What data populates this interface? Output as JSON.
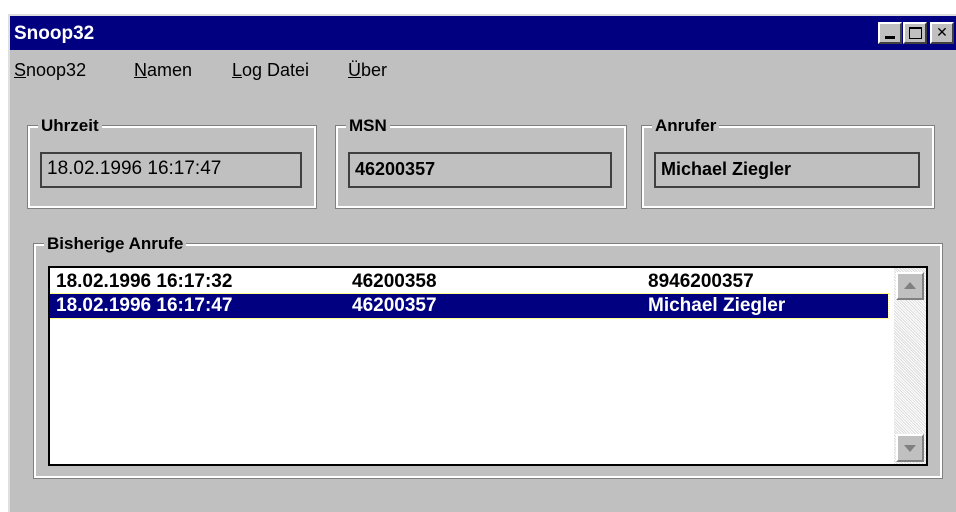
{
  "window": {
    "title": "Snoop32",
    "minimize_glyph": "",
    "maximize_glyph": "",
    "close_glyph": "✕"
  },
  "menu": [
    {
      "first": "S",
      "rest": "noop32"
    },
    {
      "first": "N",
      "rest": "amen"
    },
    {
      "first": "L",
      "rest": "og Datei"
    },
    {
      "first": "Ü",
      "rest": "ber"
    }
  ],
  "uhrzeit": {
    "label": "Uhrzeit",
    "value": "18.02.1996  16:17:47"
  },
  "msn": {
    "label": "MSN",
    "value": "46200357"
  },
  "anrufer": {
    "label": "Anrufer",
    "value": "Michael Ziegler"
  },
  "calls": {
    "label": "Bisherige Anrufe",
    "rows": [
      {
        "time": "18.02.1996  16:17:32",
        "msn": "46200358",
        "caller": "8946200357"
      },
      {
        "time": "18.02.1996  16:17:47",
        "msn": "46200357",
        "caller": "Michael Ziegler"
      }
    ],
    "selected_index": 1
  },
  "colors": {
    "titlebar": "#000080",
    "face": "#c0c0c0",
    "selection": "#000080"
  },
  "icons": {
    "scroll_up": "scroll-up-arrow-icon",
    "scroll_down": "scroll-down-arrow-icon"
  }
}
